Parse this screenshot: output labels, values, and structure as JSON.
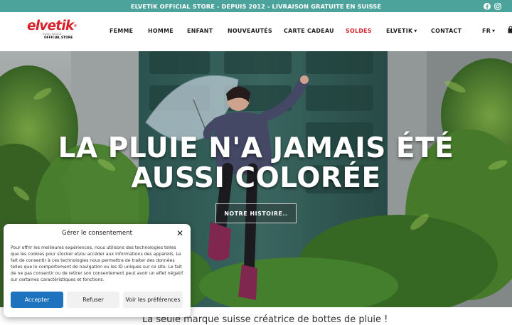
{
  "topbar": {
    "announcement": "ELVETIK OFFICIAL STORE - DEPUIS 2012 - LIVRAISON GRATUITE EN SUISSE",
    "social_icons": [
      "facebook-icon",
      "instagram-icon"
    ],
    "background": "#4ca39b"
  },
  "logo": {
    "wordmark": "elvetik",
    "tagline": "SWISS DESIGN",
    "official": "OFFICIAL STORE"
  },
  "nav": {
    "items": [
      {
        "label": "FEMME"
      },
      {
        "label": "HOMME"
      },
      {
        "label": "ENFANT"
      },
      {
        "label": "NOUVEAUTÉS"
      },
      {
        "label": "CARTE CADEAU"
      },
      {
        "label": "SOLDES"
      },
      {
        "label": "ELVETIK"
      },
      {
        "label": "CONTACT"
      }
    ],
    "language": "FR",
    "sale_color": "#d8212a"
  },
  "hero": {
    "headline_line1": "LA PLUIE N'A JAMAIS ÉTÉ",
    "headline_line2": "AUSSI COLORÉE",
    "cta_label": "NOTRE HISTOIRE.."
  },
  "below_hero": {
    "tagline": "La seule marque suisse créatrice de bottes de pluie !"
  },
  "consent": {
    "title": "Gérer le consentement",
    "body": "Pour offrir les meilleures expériences, nous utilisons des technologies telles que les cookies pour stocker et/ou accéder aux informations des appareils. Le fait de consentir à ces technologies nous permettra de traiter des données telles que le comportement de navigation ou les ID uniques sur ce site. Le fait de ne pas consentir ou de retirer son consentement peut avoir un effet négatif sur certaines caractéristiques et fonctions.",
    "accept_label": "Accepter",
    "refuse_label": "Refuser",
    "prefs_label": "Voir les préférences",
    "accent": "#1e73be"
  }
}
